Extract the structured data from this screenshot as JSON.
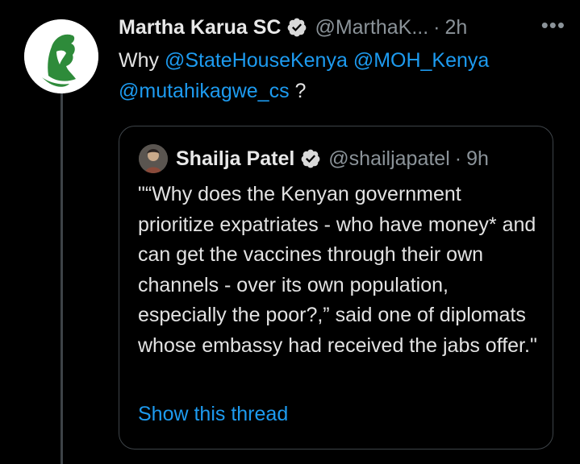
{
  "tweet": {
    "author_name": "Martha Karua SC",
    "handle": "@MarthaK...",
    "separator": "·",
    "time": "2h",
    "more": "•••",
    "text_prefix": "Why ",
    "mentions": [
      "@StateHouseKenya",
      "@MOH_Kenya",
      "@mutahikagwe_cs"
    ],
    "text_suffix": " ?"
  },
  "quoted": {
    "author_name": "Shailja Patel",
    "handle": "@shailjapatel",
    "separator": "·",
    "time": "9h",
    "text": "\"“Why does the Kenyan government prioritize expatriates - who have money* and can get the vaccines through their own channels - over its own population, especially the poor?,” said one of diplomats whose embassy had received the jabs offer.\"",
    "show_thread_label": "Show this thread"
  },
  "colors": {
    "background": "#000000",
    "link": "#1d9bf0",
    "muted": "#8b9399",
    "avatar_green": "#2e8b3a"
  },
  "icons": [
    "verified-icon",
    "more-icon"
  ]
}
